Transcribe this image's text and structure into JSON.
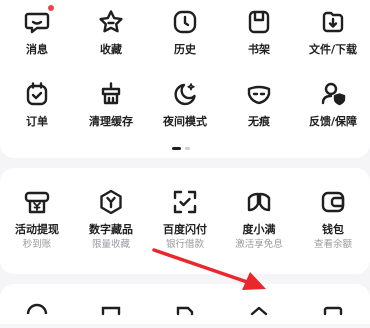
{
  "grid_row_1": [
    {
      "label": "消息",
      "icon": "message-icon",
      "badge": true
    },
    {
      "label": "收藏",
      "icon": "star-icon"
    },
    {
      "label": "历史",
      "icon": "clock-icon"
    },
    {
      "label": "书架",
      "icon": "bookshelf-icon"
    },
    {
      "label": "文件/下载",
      "icon": "download-icon"
    }
  ],
  "grid_row_2": [
    {
      "label": "订单",
      "icon": "order-icon"
    },
    {
      "label": "清理缓存",
      "icon": "clean-cache-icon"
    },
    {
      "label": "夜间模式",
      "icon": "moon-icon"
    },
    {
      "label": "无痕",
      "icon": "mask-icon"
    },
    {
      "label": "反馈/保障",
      "icon": "feedback-icon"
    }
  ],
  "pager": {
    "pages": 2,
    "active": 1
  },
  "finance_row": [
    {
      "label": "活动提现",
      "sub": "秒到账",
      "icon": "yuan-receipt-icon"
    },
    {
      "label": "数字藏品",
      "sub": "限量收藏",
      "icon": "hexagon-y-icon"
    },
    {
      "label": "百度闪付",
      "sub": "银行借款",
      "icon": "scan-check-icon"
    },
    {
      "label": "度小满",
      "sub": "激活享免息",
      "icon": "duxiaoman-icon"
    },
    {
      "label": "钱包",
      "sub": "查看余额",
      "icon": "wallet-icon"
    }
  ],
  "colors": {
    "accent_red": "#e8282d",
    "badge": "#f0424b",
    "text": "#1f1f1f",
    "subtext": "#9a9aa0"
  }
}
